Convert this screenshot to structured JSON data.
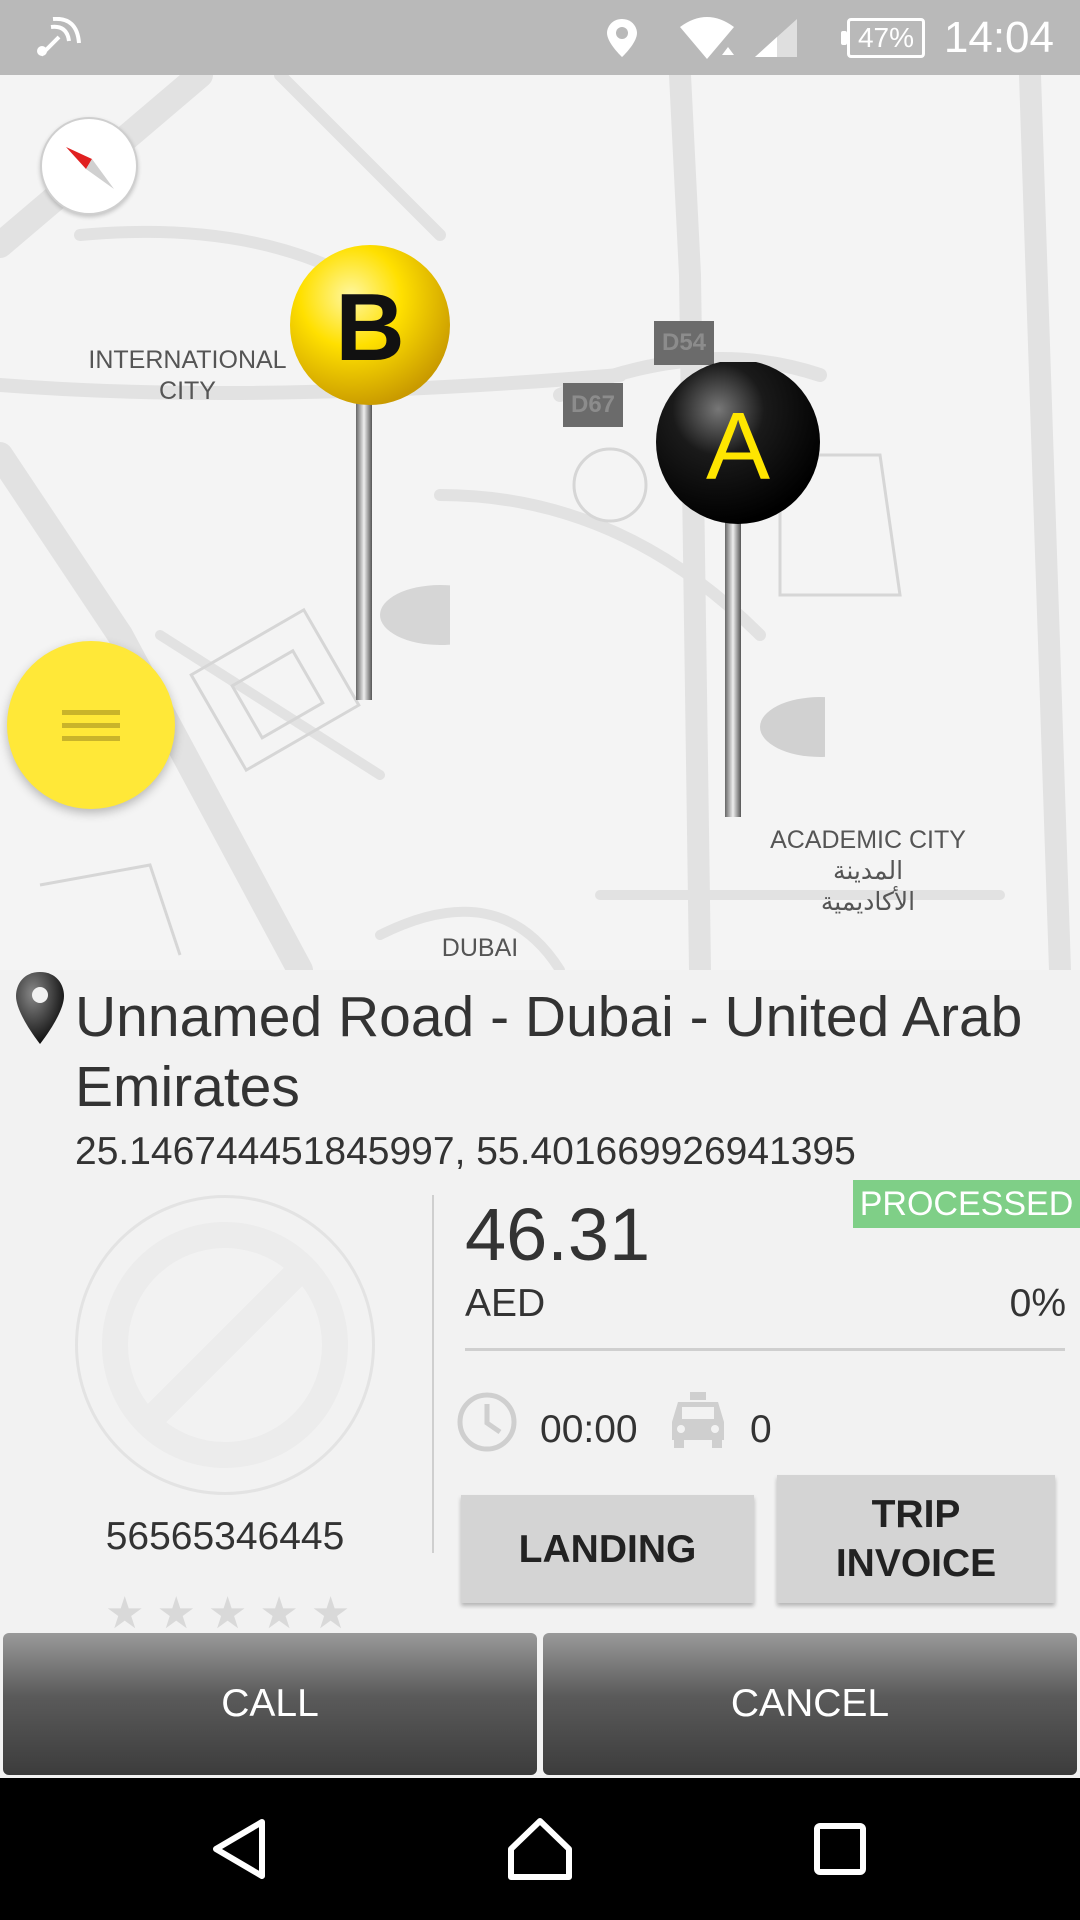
{
  "status_bar": {
    "time": "14:04",
    "battery": "47%",
    "icons": [
      "nfc-icon",
      "location-icon",
      "wifi-icon",
      "signal-icon",
      "battery-icon"
    ]
  },
  "map": {
    "labels": {
      "international_city": "INTERNATIONAL\nCITY",
      "academic_city_en": "ACADEMIC CITY",
      "academic_city_ar_1": "المدينة",
      "academic_city_ar_2": "الأكاديمية",
      "dubai": "DUBAI",
      "road_d54": "D54",
      "road_d67": "D67"
    },
    "markers": {
      "pickup": "A",
      "dropoff": "B"
    },
    "colors": {
      "pin_a": "#111111",
      "pin_a_letter": "#ffe600",
      "pin_b": "#ffe000",
      "pin_b_letter": "#111111",
      "fab": "#ffe838"
    }
  },
  "trip": {
    "address": "Unnamed Road - Dubai - United Arab Emirates",
    "coordinates": "25.146744451845997, 55.401669926941395",
    "status": "PROCESSED",
    "fare": "46.31",
    "currency": "AED",
    "discount": "0%",
    "duration": "00:00",
    "cars_count": "0",
    "driver_phone": "56565346445",
    "rating": 0,
    "rating_max": 5
  },
  "buttons": {
    "landing": "LANDING",
    "trip_invoice": "TRIP\nINVOICE",
    "call": "CALL",
    "cancel": "CANCEL"
  },
  "accent": {
    "status_green": "#7fcf87",
    "dark_button": "#444444"
  }
}
